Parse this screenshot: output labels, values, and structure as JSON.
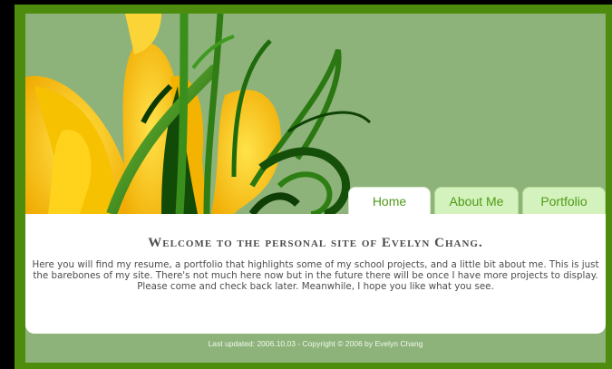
{
  "nav": {
    "tabs": [
      {
        "label": "Home"
      },
      {
        "label": "About Me"
      },
      {
        "label": "Portfolio"
      }
    ]
  },
  "main": {
    "welcome_prefix": "Welcome to the personal site of ",
    "welcome_name": "Evelyn Chang.",
    "intro": "Here you will find my resume, a portfolio that highlights some of my school projects, and a little bit about me. This is just the barebones of my site. There's not much here now but in the future there will be once I have more projects to display. Please come and check back later. Meanwhile, I hope you like what you see."
  },
  "footer": {
    "text": "Last updated: 2006.10.03 - Copyright © 2006 by Evelyn Chang"
  },
  "colors": {
    "frame": "#4e8c0e",
    "background": "#8db37a",
    "tab_text": "#4f9a17",
    "active_tab": "#ffffff",
    "inactive_tab": "#d4f2bd"
  }
}
